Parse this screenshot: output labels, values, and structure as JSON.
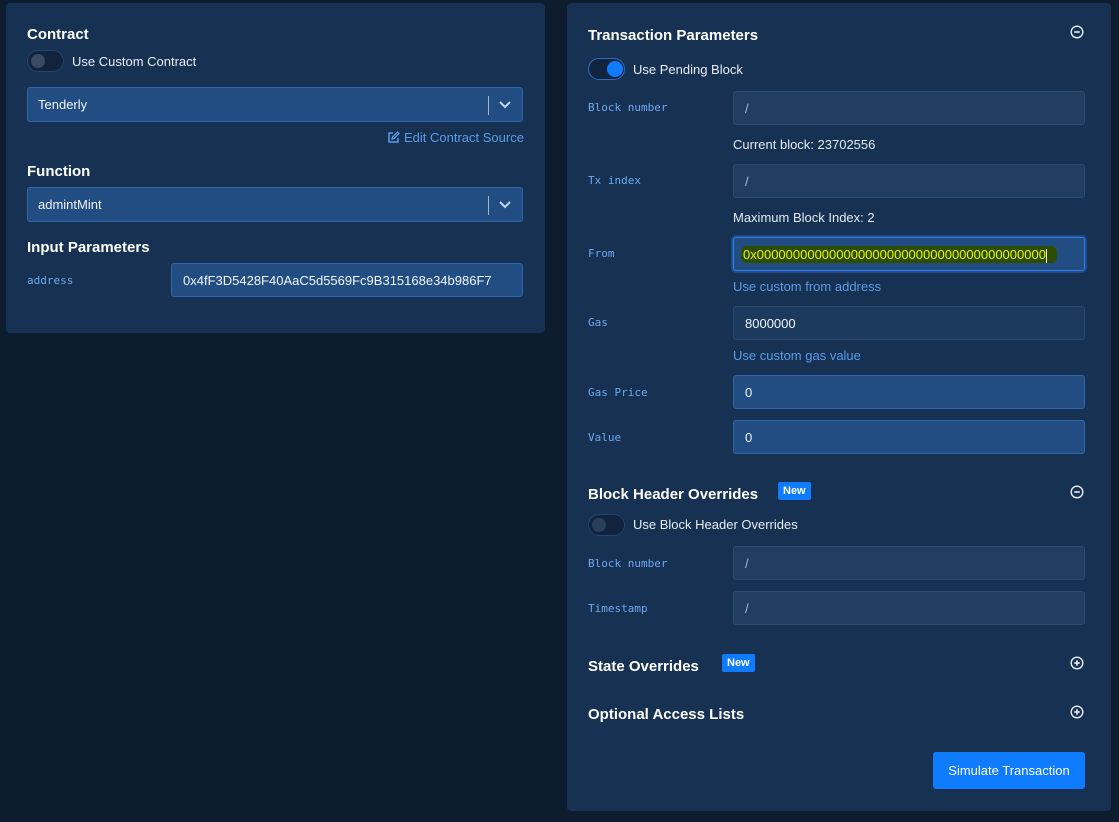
{
  "contract": {
    "heading": "Contract",
    "custom_toggle": {
      "label": "Use Custom Contract",
      "on": false
    },
    "selected_contract": "Tenderly",
    "edit_source_link": "Edit Contract Source"
  },
  "function": {
    "heading": "Function",
    "selected_function": "admintMint"
  },
  "input_parameters": {
    "heading": "Input Parameters",
    "params": [
      {
        "name": "address",
        "value": "0x4fF3D5428F40AaC5d5569Fc9B315168e34b986F7"
      }
    ]
  },
  "transaction_parameters": {
    "heading": "Transaction Parameters",
    "collapse_icon": "minus-circle-icon",
    "pending_toggle": {
      "label": "Use Pending Block",
      "on": true
    },
    "block_number": {
      "label": "Block number",
      "placeholder": "/"
    },
    "current_block_text": "Current block: 23702556",
    "tx_index": {
      "label": "Tx index",
      "placeholder": "/"
    },
    "max_block_index_text": "Maximum Block Index: 2",
    "from": {
      "label": "From",
      "value": "0x0000000000000000000000000000000000000000"
    },
    "custom_from_link": "Use custom from address",
    "gas": {
      "label": "Gas",
      "value": "8000000"
    },
    "custom_gas_link": "Use custom gas value",
    "gas_price": {
      "label": "Gas Price",
      "value": "0"
    },
    "value": {
      "label": "Value",
      "value": "0"
    }
  },
  "block_header_overrides": {
    "heading": "Block Header Overrides",
    "badge": "New",
    "collapse_icon": "minus-circle-icon",
    "toggle": {
      "label": "Use Block Header Overrides",
      "on": false
    },
    "block_number": {
      "label": "Block number",
      "placeholder": "/"
    },
    "timestamp": {
      "label": "Timestamp",
      "placeholder": "/"
    }
  },
  "state_overrides": {
    "heading": "State Overrides",
    "badge": "New",
    "expand_icon": "plus-circle-icon"
  },
  "optional_access_lists": {
    "heading": "Optional Access Lists",
    "expand_icon": "plus-circle-icon"
  },
  "simulate_button": "Simulate Transaction",
  "colors": {
    "background": "#0e1c2f",
    "panel": "#163152",
    "accent": "#0f7bff",
    "link": "#5b9ce8",
    "label": "#6ea8f0"
  }
}
